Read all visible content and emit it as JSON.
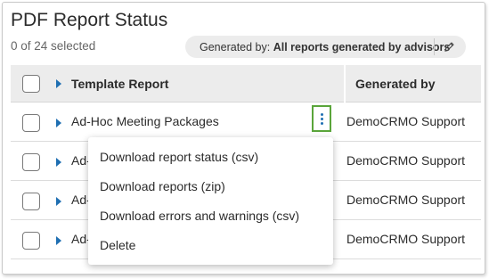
{
  "page": {
    "title": "PDF Report Status",
    "selected_count": "0 of 24 selected"
  },
  "filter": {
    "label": "Generated by:",
    "value": "All reports generated by advisors",
    "edit_icon": "pencil-icon"
  },
  "table": {
    "columns": [
      "Template Report",
      "Generated by"
    ],
    "rows": [
      {
        "name": "Ad-Hoc Meeting Packages",
        "generated_by": "DemoCRMO Support"
      },
      {
        "name": "Ad-",
        "generated_by": "DemoCRMO Support"
      },
      {
        "name": "Ad-",
        "generated_by": "DemoCRMO Support"
      },
      {
        "name": "Ad-",
        "generated_by": "DemoCRMO Support"
      }
    ]
  },
  "menu": {
    "items": [
      "Download report status (csv)",
      "Download reports (zip)",
      "Download errors and warnings (csv)",
      "Delete"
    ]
  },
  "colors": {
    "accent_blue": "#1f6fb2",
    "kebab_highlight": "#5aa53a",
    "header_bg": "#ececec"
  }
}
